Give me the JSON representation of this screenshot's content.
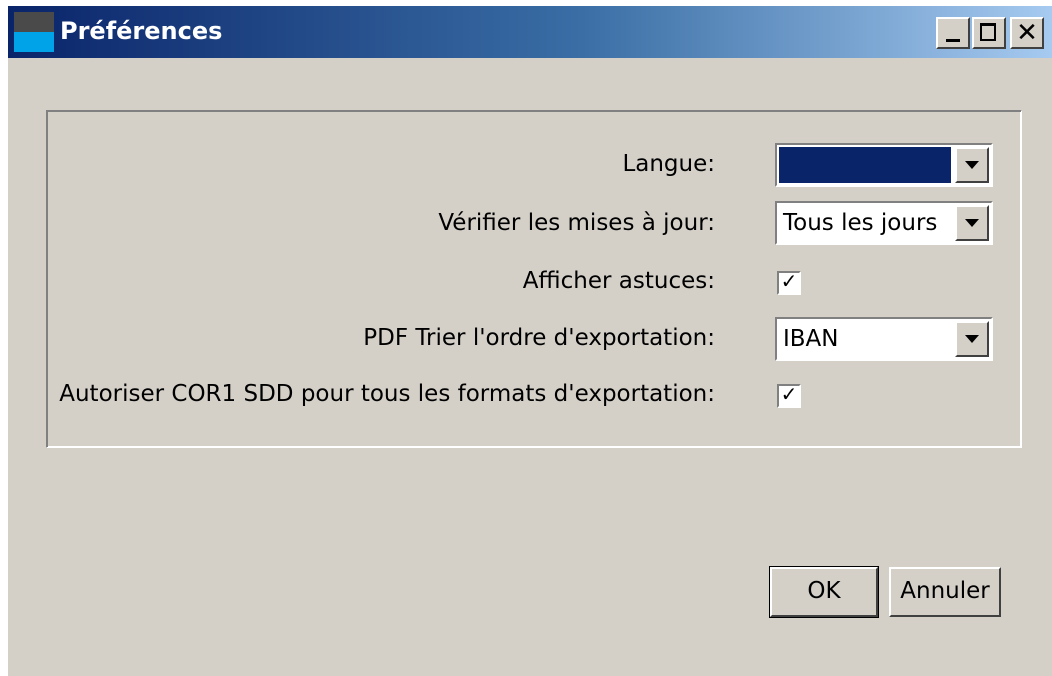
{
  "window": {
    "title": "Préférences",
    "close_glyph": "✕"
  },
  "form": {
    "language": {
      "label": "Langue:",
      "value": ""
    },
    "updates": {
      "label": "Vérifier les mises à jour:",
      "value": "Tous les jours"
    },
    "tips": {
      "label": "Afficher astuces:",
      "checked": true,
      "mark": "✓"
    },
    "pdf_sort": {
      "label": "PDF Trier l'ordre d'exportation:",
      "value": "IBAN"
    },
    "cor1": {
      "label": "Autoriser COR1 SDD pour tous les formats d'exportation:",
      "checked": true,
      "mark": "✓"
    }
  },
  "buttons": {
    "ok": "OK",
    "cancel": "Annuler"
  },
  "colors": {
    "selection": "#0a246a",
    "face": "#d4d0c8"
  }
}
